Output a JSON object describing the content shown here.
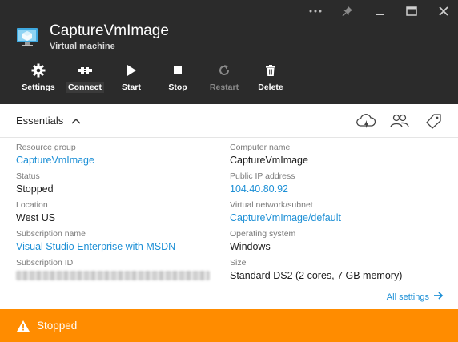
{
  "window": {
    "controls": [
      {
        "icon": "more-icon"
      },
      {
        "icon": "pin-icon"
      },
      {
        "icon": "minimize-icon"
      },
      {
        "icon": "maximize-icon"
      },
      {
        "icon": "close-icon"
      }
    ]
  },
  "blade": {
    "title": "CaptureVmImage",
    "subtitle": "Virtual machine"
  },
  "toolbar": {
    "settings": "Settings",
    "connect": "Connect",
    "start": "Start",
    "stop": "Stop",
    "restart": "Restart",
    "delete": "Delete"
  },
  "essentials": {
    "title": "Essentials",
    "action_icons": [
      "cloud-icon",
      "users-icon",
      "tag-icon"
    ]
  },
  "properties": {
    "left": [
      {
        "label": "Resource group",
        "value": "CaptureVmImage"
      },
      {
        "label": "Status",
        "value": "Stopped"
      },
      {
        "label": "Location",
        "value": "West US"
      },
      {
        "label": "Subscription name",
        "value": "Visual Studio Enterprise with MSDN"
      },
      {
        "label": "Subscription ID",
        "value": ""
      }
    ],
    "right": [
      {
        "label": "Computer name",
        "value": "CaptureVmImage"
      },
      {
        "label": "Public IP address",
        "value": "104.40.80.92"
      },
      {
        "label": "Virtual network/subnet",
        "value": "CaptureVmImage/default"
      },
      {
        "label": "Operating system",
        "value": "Windows"
      },
      {
        "label": "Size",
        "value": "Standard DS2 (2 cores, 7 GB memory)"
      }
    ]
  },
  "all_settings": "All settings",
  "status_bar": {
    "text": "Stopped",
    "color": "#ff8c00"
  }
}
